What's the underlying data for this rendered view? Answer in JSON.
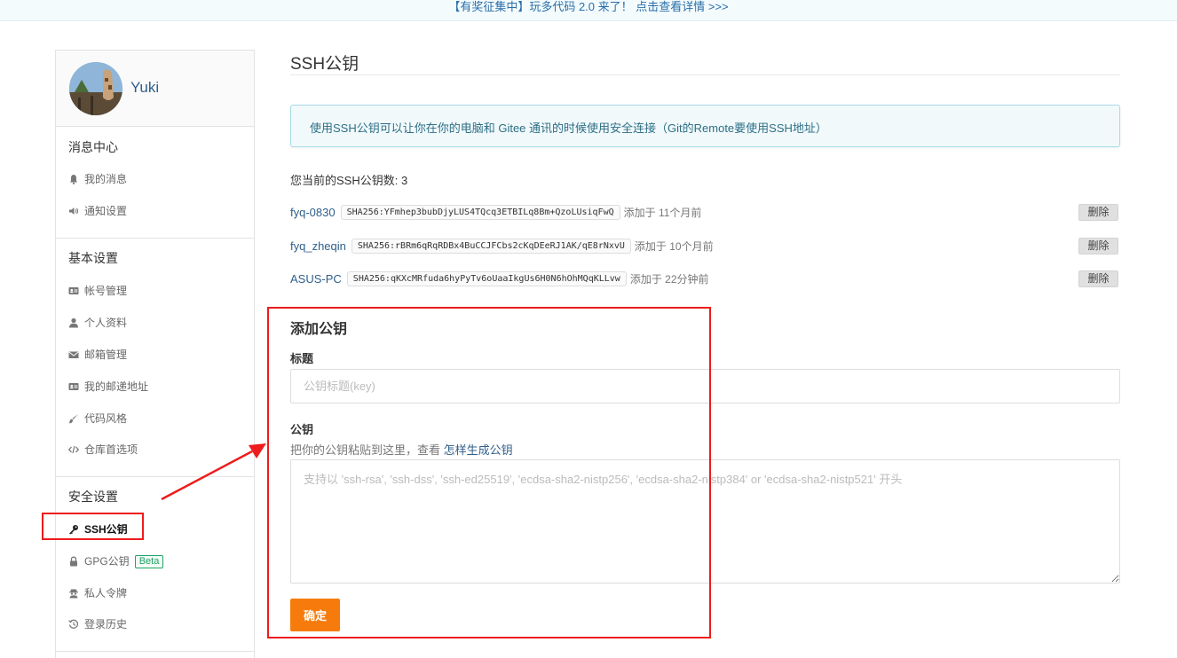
{
  "banner": {
    "text": "【有奖征集中】玩多代码 2.0 来了！ 点击查看详情 >>>"
  },
  "sidebar": {
    "username": "Yuki",
    "sections": [
      {
        "title": "消息中心",
        "items": [
          "我的消息",
          "通知设置"
        ]
      },
      {
        "title": "基本设置",
        "items": [
          "帐号管理",
          "个人资料",
          "邮箱管理",
          "我的邮递地址",
          "代码风格",
          "仓库首选项"
        ]
      },
      {
        "title": "安全设置",
        "items": [
          "SSH公钥",
          "GPG公钥",
          "私人令牌",
          "登录历史"
        ]
      }
    ],
    "active_item": "SSH公钥",
    "beta_badge": "Beta",
    "icons": [
      "bell-icon",
      "volume-icon",
      "id-card-icon",
      "user-icon",
      "envelope-icon",
      "id-card-icon",
      "brush-icon",
      "code-icon",
      "key-icon",
      "lock-icon",
      "user-secret-icon",
      "history-icon"
    ]
  },
  "main": {
    "title": "SSH公钥",
    "info": "使用SSH公钥可以让你在你的电脑和 Gitee 通讯的时候使用安全连接（Git的Remote要使用SSH地址）",
    "count_text": "您当前的SSH公钥数: 3",
    "keys": [
      {
        "name": "fyq-0830",
        "fingerprint": "SHA256:YFmhep3bubDjyLUS4TQcq3ETBILq8Bm+QzoLUsiqFwQ",
        "added": "添加于 11个月前",
        "delete": "删除"
      },
      {
        "name": "fyq_zheqin",
        "fingerprint": "SHA256:rBRm6qRqRDBx4BuCCJFCbs2cKqDEeRJ1AK/qE8rNxvU",
        "added": "添加于 10个月前",
        "delete": "删除"
      },
      {
        "name": "ASUS-PC",
        "fingerprint": "SHA256:qKXcMRfuda6hyPyTv6oUaaIkgUs6H0N6hOhMQqKLLvw",
        "added": "添加于 22分钟前",
        "delete": "删除"
      }
    ],
    "add": {
      "heading": "添加公钥",
      "title_label": "标题",
      "title_placeholder": "公钥标题(key)",
      "key_label": "公钥",
      "hint_text": "把你的公钥粘贴到这里，查看 ",
      "hint_link": "怎样生成公钥",
      "key_placeholder": "支持以 'ssh-rsa', 'ssh-dss', 'ssh-ed25519', 'ecdsa-sha2-nistp256', 'ecdsa-sha2-nistp384' or 'ecdsa-sha2-nistp521' 开头",
      "submit": "确定"
    }
  },
  "colors": {
    "accent_orange": "#f77b0c",
    "link_blue": "#2f5f8a",
    "annotation_red": "#ee1c1c",
    "beta_green": "#21a366"
  }
}
